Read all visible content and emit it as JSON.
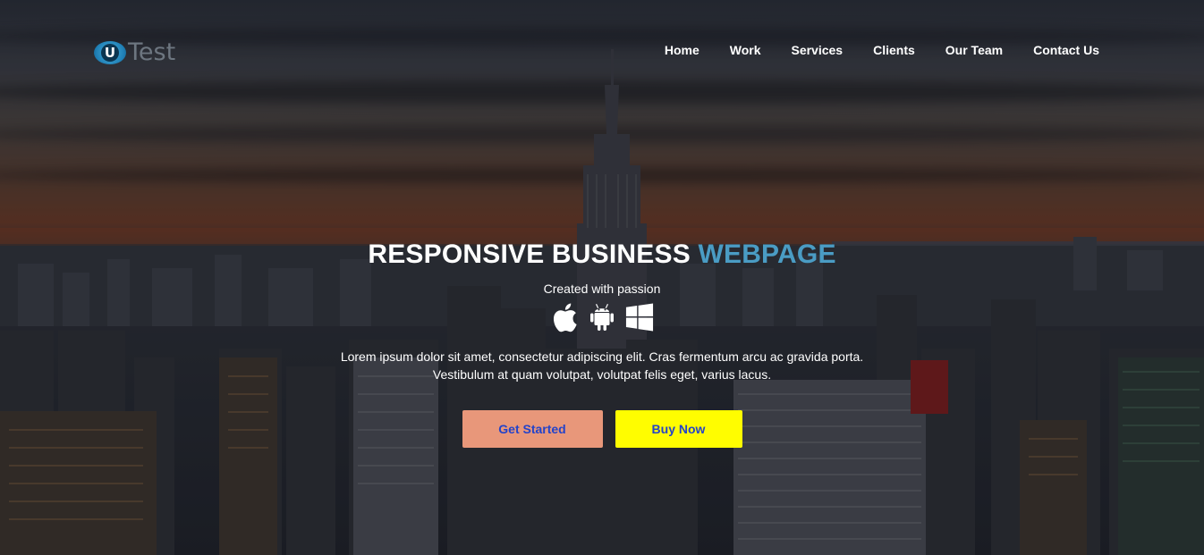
{
  "brand": {
    "logo_letter": "U",
    "logo_text": "Test"
  },
  "nav": {
    "items": [
      "Home",
      "Work",
      "Services",
      "Clients",
      "Our Team",
      "Contact Us"
    ]
  },
  "hero": {
    "headline_main": "RESPONSIVE BUSINESS",
    "headline_accent": "WEBPAGE",
    "tagline": "Created with passion",
    "description_line1": "Lorem ipsum dolor sit amet, consectetur adipiscing elit. Cras fermentum arcu ac gravida porta.",
    "description_line2": "Vestibulum at quam volutpat, volutpat felis eget, varius lacus.",
    "platform_icons": [
      "apple-icon",
      "android-icon",
      "windows-icon"
    ],
    "primary_button": "Get Started",
    "secondary_button": "Buy Now"
  },
  "colors": {
    "accent": "#4a9cc4",
    "primary_button_bg": "#e8977a",
    "secondary_button_bg": "#fffd00",
    "button_text": "#2443c9"
  }
}
